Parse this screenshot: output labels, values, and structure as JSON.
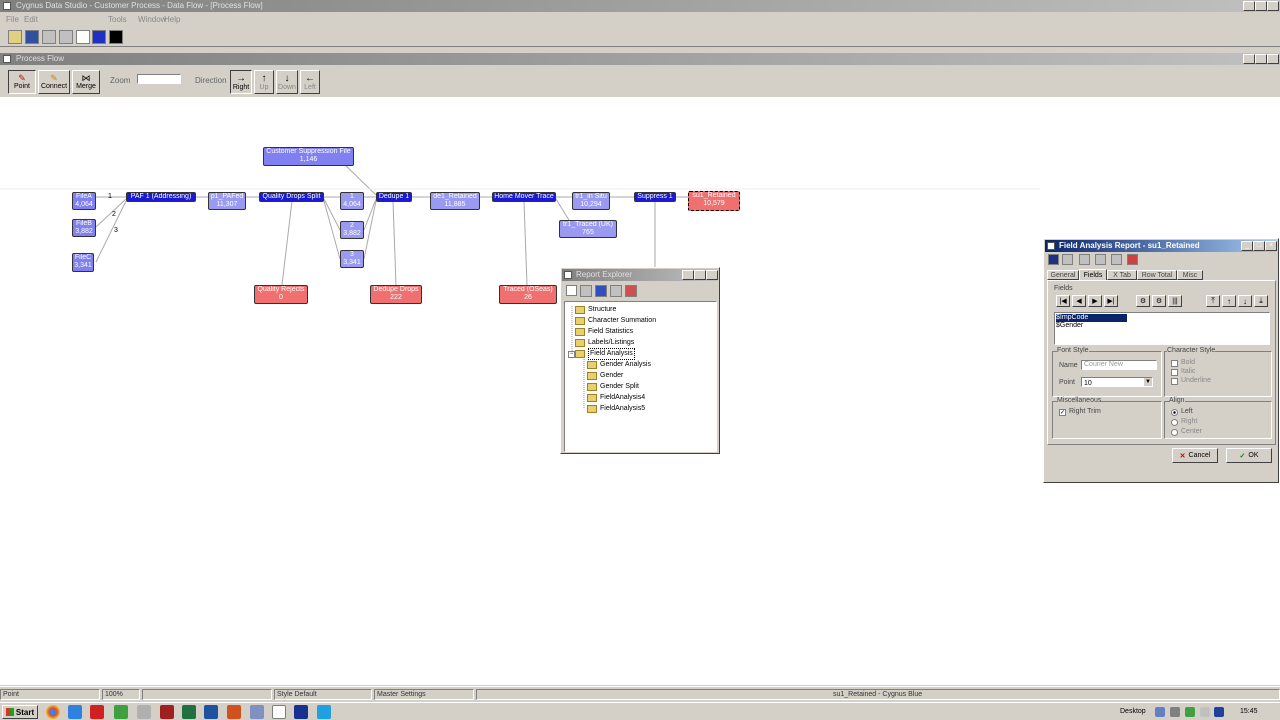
{
  "app_window": {
    "title": "Cygnus Data Studio - Customer Process - Data Flow - [Process Flow]",
    "menu": [
      "File",
      "Edit",
      "Tools",
      "Window",
      "Help"
    ]
  },
  "process_window": {
    "title": "Process Flow"
  },
  "flow_toolbar": {
    "point_label": "Point",
    "connect_label": "Connect",
    "merge_label": "Merge",
    "zoom_label": "Zoom",
    "direction_label": "Direction",
    "right_label": "Right",
    "up_label": "Up",
    "down_label": "Down",
    "left_label": "Left"
  },
  "nodes": {
    "cust_supp": {
      "name": "Customer Suppression File",
      "count": "1,146"
    },
    "filea": {
      "name": "FileA",
      "count": "4,064"
    },
    "fileb": {
      "name": "FileB",
      "count": "3,882"
    },
    "filec": {
      "name": "FileC",
      "count": "3,341"
    },
    "paf": {
      "name": "PAF 1 (Addressing)"
    },
    "p1_pafed": {
      "name": "p1_PAFed",
      "count": "11,307"
    },
    "quality_split": {
      "name": "Quality Drops Split"
    },
    "split1": {
      "name": "1",
      "count": "4,064"
    },
    "split2": {
      "name": "2",
      "count": "3,882"
    },
    "split3": {
      "name": "3",
      "count": "3,341"
    },
    "dedupe1": {
      "name": "Dedupe 1"
    },
    "de1_retained": {
      "name": "de1_Retained",
      "count": "11,885"
    },
    "home_mover": {
      "name": "Home Mover Trace"
    },
    "tr1_in_situ": {
      "name": "tr1_in Situ",
      "count": "10,294"
    },
    "tr1_traced": {
      "name": "tr1_Traced (UK)",
      "count": "765"
    },
    "suppress1": {
      "name": "Suppress 1"
    },
    "su1_retained": {
      "name": "su1_Retained",
      "count": "10,579"
    },
    "quality_rejects": {
      "name": "Quality Rejects",
      "count": "0"
    },
    "dedupe_drops": {
      "name": "Dedupe Drops",
      "count": "222"
    },
    "traced_oseas": {
      "name": "Traced (OSeas)",
      "count": "26"
    },
    "conn1": "1",
    "conn2": "2",
    "conn3": "3"
  },
  "tree_window": {
    "title": "Report Explorer",
    "items": [
      {
        "label": "Structure",
        "level": 0
      },
      {
        "label": "Character Summation",
        "level": 0
      },
      {
        "label": "Field Statistics",
        "level": 0
      },
      {
        "label": "Labels/Listings",
        "level": 0
      },
      {
        "label": "Field Analysis",
        "level": 0,
        "selected": true
      },
      {
        "label": "Gender Analysis",
        "level": 1
      },
      {
        "label": "Gender",
        "level": 1
      },
      {
        "label": "Gender Split",
        "level": 1
      },
      {
        "label": "FieldAnalysis4",
        "level": 1
      },
      {
        "label": "FieldAnalysis5",
        "level": 1
      }
    ]
  },
  "report_dialog": {
    "title": "Field Analysis Report - su1_Retained",
    "tabs": [
      "General",
      "Fields",
      "X Tab",
      "Row Total",
      "Misc"
    ],
    "fields_label": "Fields",
    "fields": [
      "$ImpCode",
      "$Gender"
    ],
    "font_style_label": "Font Style",
    "name_label": "Name",
    "name_value": "Courier New",
    "point_label": "Point",
    "point_value": "10",
    "char_style_label": "Character Style",
    "bold_label": "Bold",
    "italic_label": "Italic",
    "underline_label": "Underline",
    "misc_label": "Miscellaneous",
    "right_trim_label": "Right Trim",
    "align_label": "Align",
    "left_label": "Left",
    "right_label": "Right",
    "center_label": "Center",
    "cancel_label": "Cancel",
    "ok_label": "OK"
  },
  "status_bar": {
    "mode": "Point",
    "zoom": "100%",
    "style": "Style Default",
    "settings": "Master Settings",
    "selection": "su1_Retained - Cygnus Blue"
  },
  "taskbar": {
    "start_label": "Start",
    "desktop_label": "Desktop",
    "clock": "15:45"
  }
}
